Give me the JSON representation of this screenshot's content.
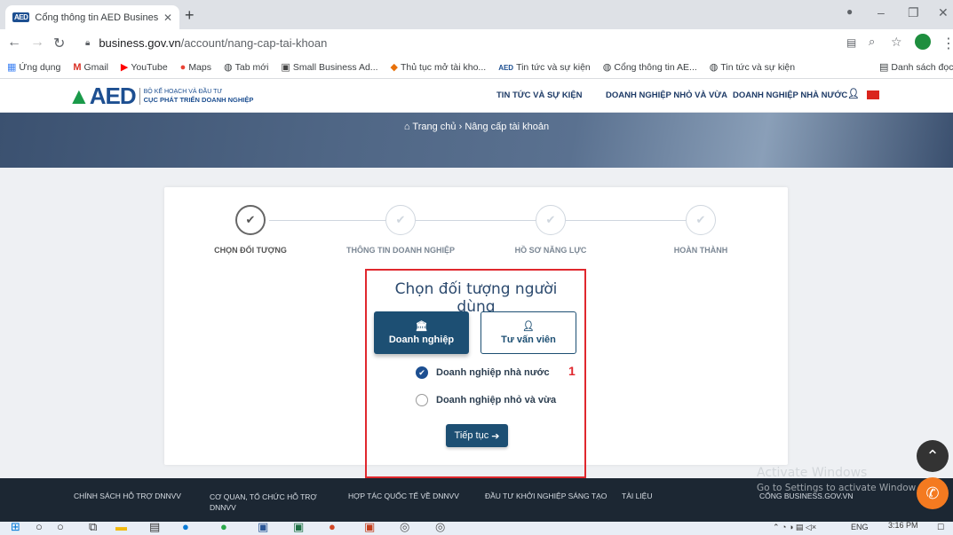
{
  "browser": {
    "tab_title": "Cổng thông tin AED Business Po",
    "tab_favicon": "AED",
    "new_tab": "+",
    "url_host": "business.gov.vn",
    "url_path": "/account/nang-cap-tai-khoan",
    "bookmarks": [
      "Ứng dụng",
      "Gmail",
      "YouTube",
      "Maps",
      "Tab mới",
      "Small Business Ad...",
      "Thủ tục mở tài kho...",
      "Tin tức và sự kiện",
      "Cổng thông tin AE...",
      "Tin tức và sự kiện"
    ],
    "reading_list": "Danh sách đọc"
  },
  "site": {
    "logo_text": "AED",
    "logo_line1": "BỘ KẾ HOẠCH VÀ ĐẦU TƯ",
    "logo_line2": "CỤC PHÁT TRIỂN DOANH NGHIỆP",
    "menu": [
      "TIN TỨC VÀ SỰ KIỆN",
      "DOANH NGHIỆP NHỎ VÀ VỪA",
      "DOANH NGHIỆP NHÀ NƯỚC"
    ],
    "breadcrumb_home": "Trang chủ",
    "breadcrumb_sep": "›",
    "breadcrumb_current": "Nâng cấp tài khoản"
  },
  "steps": [
    "CHỌN ĐỐI TƯỢNG",
    "THÔNG TIN DOANH NGHIỆP",
    "HỒ SƠ NĂNG LỰC",
    "HOÀN THÀNH"
  ],
  "form": {
    "title": "Chọn đối tượng người dùng",
    "type_business": "Doanh nghiệp",
    "type_consultant": "Tư vấn viên",
    "option_state": "Doanh nghiệp nhà nước",
    "option_sme": "Doanh nghiệp nhỏ và vừa",
    "annotation": "1",
    "next_label": "Tiếp tục"
  },
  "footer": [
    "CHÍNH SÁCH HỖ TRỢ DNNVV",
    "CƠ QUAN, TỔ CHỨC HỖ TRỢ DNNVV",
    "HỢP TÁC QUỐC TẾ VỀ DNNVV",
    "ĐẦU TƯ KHỞI NGHIỆP SÁNG TẠO",
    "TÀI LIỆU",
    "CỔNG BUSINESS.GOV.VN"
  ],
  "watermark": {
    "line1": "Activate Windows",
    "line2": "Go to Settings to activate Window"
  },
  "taskbar": {
    "lang": "ENG",
    "time": "3:16 PM"
  },
  "colors": {
    "primary": "#1d4f73",
    "highlight": "#e0282e",
    "footer": "#1c2733"
  }
}
